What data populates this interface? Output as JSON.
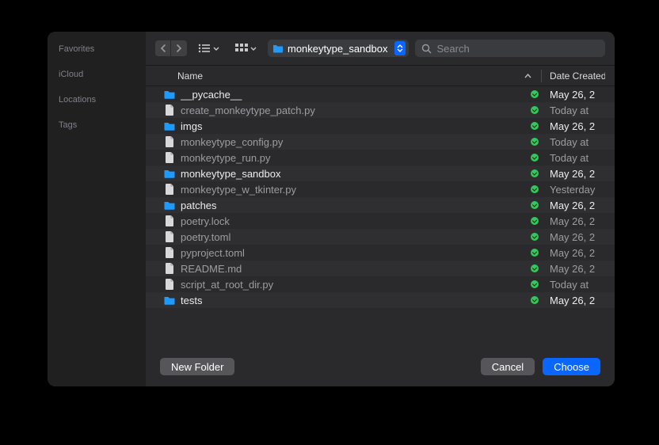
{
  "sidebar": {
    "headings": [
      "Favorites",
      "iCloud",
      "Locations",
      "Tags"
    ]
  },
  "toolbar": {
    "path_label": "monkeytype_sandbox",
    "search_placeholder": "Search"
  },
  "columns": {
    "name": "Name",
    "date": "Date Created"
  },
  "files": [
    {
      "name": "__pycache__",
      "type": "folder",
      "date": "May 26, 2"
    },
    {
      "name": "create_monkeytype_patch.py",
      "type": "file",
      "date": "Today at "
    },
    {
      "name": "imgs",
      "type": "folder",
      "date": "May 26, 2"
    },
    {
      "name": "monkeytype_config.py",
      "type": "file",
      "date": "Today at "
    },
    {
      "name": "monkeytype_run.py",
      "type": "file",
      "date": "Today at "
    },
    {
      "name": "monkeytype_sandbox",
      "type": "folder",
      "date": "May 26, 2"
    },
    {
      "name": "monkeytype_w_tkinter.py",
      "type": "file",
      "date": "Yesterday"
    },
    {
      "name": "patches",
      "type": "folder",
      "date": "May 26, 2"
    },
    {
      "name": "poetry.lock",
      "type": "file",
      "date": "May 26, 2"
    },
    {
      "name": "poetry.toml",
      "type": "file",
      "date": "May 26, 2"
    },
    {
      "name": "pyproject.toml",
      "type": "file",
      "date": "May 26, 2"
    },
    {
      "name": "README.md",
      "type": "file",
      "date": "May 26, 2"
    },
    {
      "name": "script_at_root_dir.py",
      "type": "file",
      "date": "Today at "
    },
    {
      "name": "tests",
      "type": "folder",
      "date": "May 26, 2"
    }
  ],
  "footer": {
    "new_folder": "New Folder",
    "cancel": "Cancel",
    "choose": "Choose"
  },
  "colors": {
    "accent": "#0a66ff",
    "sync_ok": "#34c759",
    "folder_icon": "#1e9bff"
  }
}
